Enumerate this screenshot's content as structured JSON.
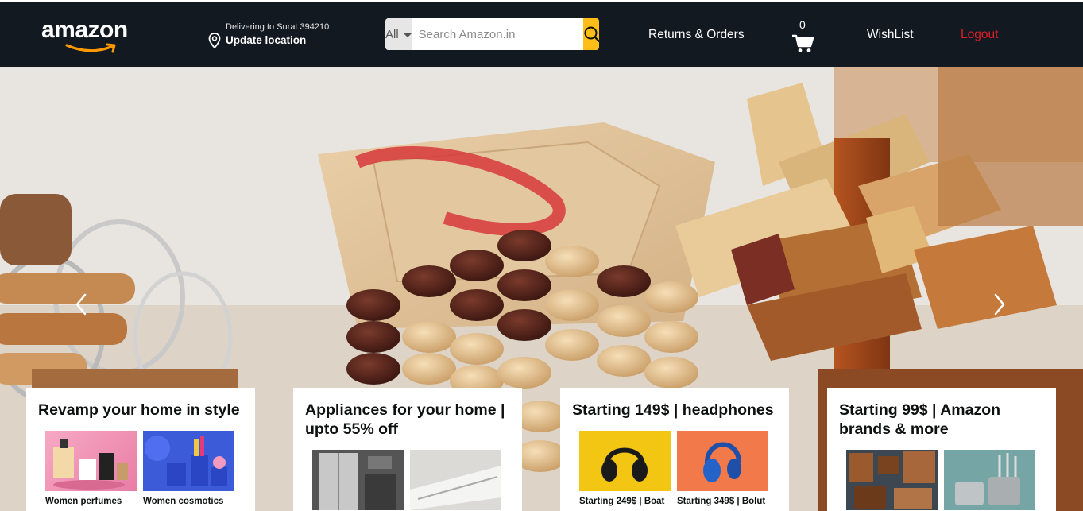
{
  "header": {
    "logo_text": "amazon",
    "location": {
      "line1": "Delivering to Surat 394210",
      "line2": "Update location"
    },
    "search": {
      "category": "All",
      "placeholder": "Search Amazon.in"
    },
    "returns_orders": "Returns & Orders",
    "cart_count": "0",
    "wishlist": "WishList",
    "logout": "Logout"
  },
  "colors": {
    "nav_bg": "#131921",
    "search_button": "#febd17",
    "logout": "#e11d24",
    "logo_smile": "#ff9900"
  },
  "hero": {
    "prev_icon": "chevron-left-icon",
    "next_icon": "chevron-right-icon"
  },
  "cards": [
    {
      "title": "Revamp your home in style",
      "items": [
        {
          "caption": "Women perfumes and more"
        },
        {
          "caption": "Women cosmotics and more"
        }
      ]
    },
    {
      "title": "Appliances for your home | upto 55% off",
      "items": [
        {
          "caption": ""
        },
        {
          "caption": ""
        }
      ]
    },
    {
      "title": "Starting 149$ | headphones",
      "items": [
        {
          "caption": "Starting 249$ | Boat"
        },
        {
          "caption": "Starting 349$ | Bolut"
        }
      ]
    },
    {
      "title": "Starting 99$ | Amazon brands & more",
      "items": [
        {
          "caption": ""
        },
        {
          "caption": ""
        }
      ]
    }
  ]
}
